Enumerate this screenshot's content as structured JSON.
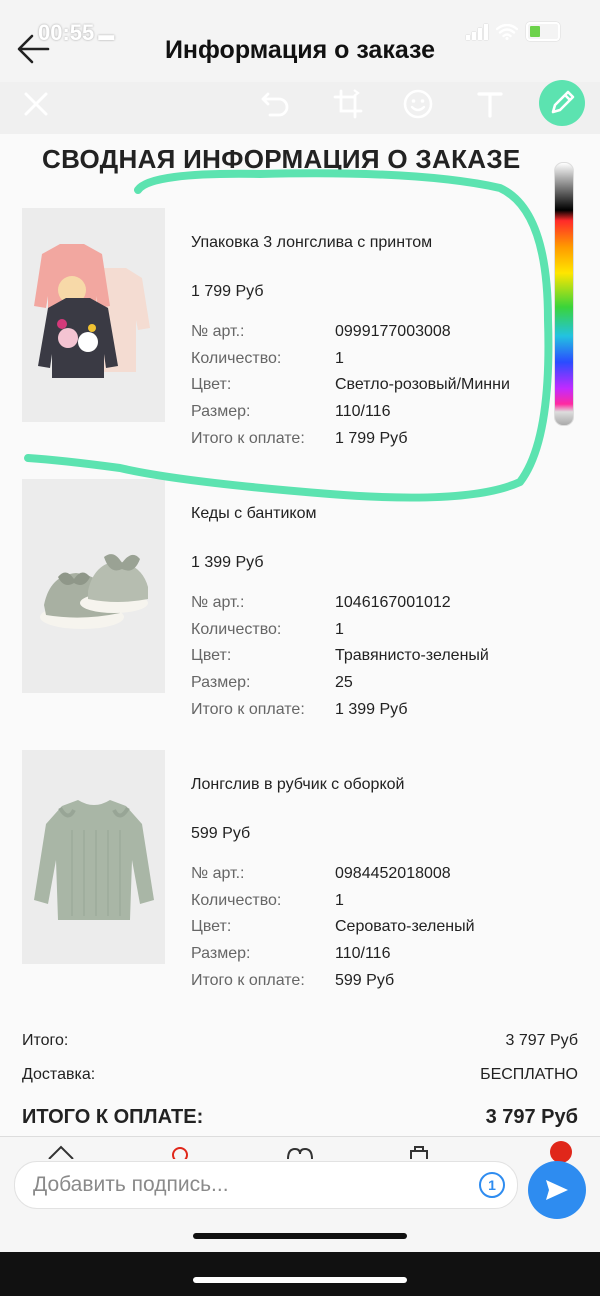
{
  "status": {
    "time": "00:55"
  },
  "header": {
    "title": "Информация о заказе"
  },
  "toolbar": {
    "tools": [
      "close-icon",
      "undo-icon",
      "crop-icon",
      "sticker-icon",
      "text-icon",
      "pen-icon"
    ],
    "accent": "#5ce3b0"
  },
  "summary": {
    "title": "СВОДНАЯ ИНФОРМАЦИЯ О ЗАКАЗЕ"
  },
  "labels": {
    "article": "№ арт.:",
    "quantity": "Количество:",
    "color": "Цвет:",
    "size": "Размер:",
    "total": "Итого к оплате:"
  },
  "items": [
    {
      "name": "Упаковка 3 лонгслива с принтом",
      "price": "1 799 Руб",
      "article": "0999177003008",
      "quantity": "1",
      "color": "Светло-розовый/Минни",
      "size": "110/116",
      "total": "1 799 Руб"
    },
    {
      "name": "Кеды с бантиком",
      "price": "1 399 Руб",
      "article": "1046167001012",
      "quantity": "1",
      "color": "Травянисто-зеленый",
      "size": "25",
      "total": "1 399 Руб"
    },
    {
      "name": "Лонгслив в рубчик с оборкой",
      "price": "599 Руб",
      "article": "0984452018008",
      "quantity": "1",
      "color": "Серовато-зеленый",
      "size": "110/116",
      "total": "599 Руб"
    }
  ],
  "totals": {
    "subtotal_label": "Итого:",
    "subtotal_value": "3 797 Руб",
    "delivery_label": "Доставка:",
    "delivery_value": "БЕСПЛАТНО",
    "grand_label": "ИТОГО К ОПЛАТЕ:",
    "grand_value": "3 797 Руб"
  },
  "caption": {
    "placeholder": "Добавить подпись...",
    "once_label": "1"
  },
  "colors": {
    "send": "#2e8cf0",
    "badge": "#e0271a",
    "scribble": "#5ce3b0"
  }
}
